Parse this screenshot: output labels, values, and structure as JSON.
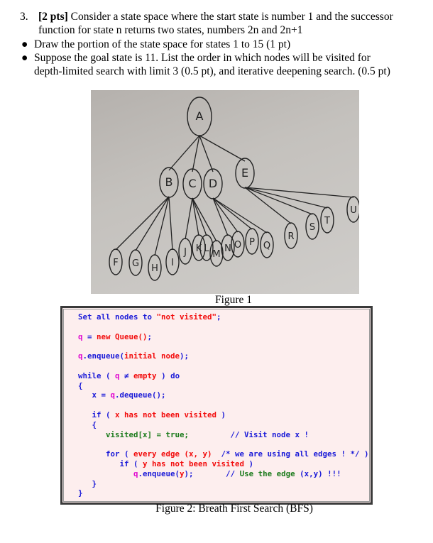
{
  "question": {
    "number": "3.",
    "points": "[2 pts]",
    "text_line1": " Consider a state space where the start state is number 1 and the successor",
    "text_line2": "function for state n returns two states, numbers 2n and 2n+1",
    "bullets": [
      {
        "icon": "bullet-icon",
        "line1": "Draw the portion of the state space for states 1 to 15 (1 pt)"
      },
      {
        "icon": "bullet-icon",
        "line1": "Suppose the goal state is 11. List the order in which nodes will be visited for",
        "line2": "depth-limited search with limit 3 (0.5 pt), and iterative deepening search. (0.5 pt)"
      }
    ]
  },
  "figure1": {
    "caption": "Figure 1",
    "tree": {
      "nodes": [
        "A",
        "B",
        "C",
        "D",
        "E",
        "F",
        "G",
        "H",
        "I",
        "J",
        "K",
        "L",
        "M",
        "N",
        "O",
        "P",
        "Q",
        "R",
        "S",
        "T",
        "U"
      ],
      "edges": [
        [
          "A",
          "B"
        ],
        [
          "A",
          "C"
        ],
        [
          "A",
          "D"
        ],
        [
          "A",
          "E"
        ],
        [
          "B",
          "F"
        ],
        [
          "B",
          "G"
        ],
        [
          "B",
          "H"
        ],
        [
          "B",
          "I"
        ],
        [
          "C",
          "J"
        ],
        [
          "C",
          "K"
        ],
        [
          "C",
          "L"
        ],
        [
          "C",
          "M"
        ],
        [
          "D",
          "N"
        ],
        [
          "D",
          "O"
        ],
        [
          "D",
          "P"
        ],
        [
          "D",
          "Q"
        ],
        [
          "E",
          "R"
        ],
        [
          "E",
          "S"
        ],
        [
          "E",
          "T"
        ],
        [
          "E",
          "U"
        ]
      ]
    }
  },
  "figure2": {
    "caption": "Figure 2: Breath First Search (BFS)",
    "code": [
      [
        {
          "t": "Set all nodes to ",
          "c": "b"
        },
        {
          "t": "\"not visited\"",
          "c": "r"
        },
        {
          "t": ";",
          "c": "b"
        }
      ],
      [],
      [
        {
          "t": "q",
          "c": "m"
        },
        {
          "t": " = ",
          "c": "b"
        },
        {
          "t": "new Queue()",
          "c": "r"
        },
        {
          "t": ";",
          "c": "b"
        }
      ],
      [],
      [
        {
          "t": "q",
          "c": "m"
        },
        {
          "t": ".enqueue(",
          "c": "b"
        },
        {
          "t": "initial node",
          "c": "r"
        },
        {
          "t": ");",
          "c": "b"
        }
      ],
      [],
      [
        {
          "t": "while ( ",
          "c": "b"
        },
        {
          "t": "q",
          "c": "m"
        },
        {
          "t": " ≠ ",
          "c": "b"
        },
        {
          "t": "empty",
          "c": "r"
        },
        {
          "t": " ) do",
          "c": "b"
        }
      ],
      [
        {
          "t": "{",
          "c": "b"
        }
      ],
      [
        {
          "t": "   x = ",
          "c": "b"
        },
        {
          "t": "q",
          "c": "m"
        },
        {
          "t": ".dequeue();",
          "c": "b"
        }
      ],
      [],
      [
        {
          "t": "   if ( ",
          "c": "b"
        },
        {
          "t": "x has not been visited",
          "c": "r"
        },
        {
          "t": " )",
          "c": "b"
        }
      ],
      [
        {
          "t": "   {",
          "c": "b"
        }
      ],
      [
        {
          "t": "      visited[x] = true;",
          "c": "g"
        },
        {
          "t": "         // Visit node x !",
          "c": "b"
        }
      ],
      [],
      [
        {
          "t": "      for ( ",
          "c": "b"
        },
        {
          "t": "every edge (x, y)",
          "c": "r"
        },
        {
          "t": "  /* we are using all edges ! */ )",
          "c": "b"
        }
      ],
      [
        {
          "t": "         if ( ",
          "c": "b"
        },
        {
          "t": "y has not been visited",
          "c": "r"
        },
        {
          "t": " )",
          "c": "b"
        }
      ],
      [
        {
          "t": "            q",
          "c": "m"
        },
        {
          "t": ".enqueue(",
          "c": "b"
        },
        {
          "t": "y",
          "c": "r"
        },
        {
          "t": ");",
          "c": "b"
        },
        {
          "t": "       // ",
          "c": "b"
        },
        {
          "t": "Use the edge",
          "c": "g"
        },
        {
          "t": " (x,y) !!!",
          "c": "b"
        }
      ],
      [
        {
          "t": "   }",
          "c": "b"
        }
      ],
      [
        {
          "t": "}",
          "c": "b"
        }
      ]
    ]
  }
}
